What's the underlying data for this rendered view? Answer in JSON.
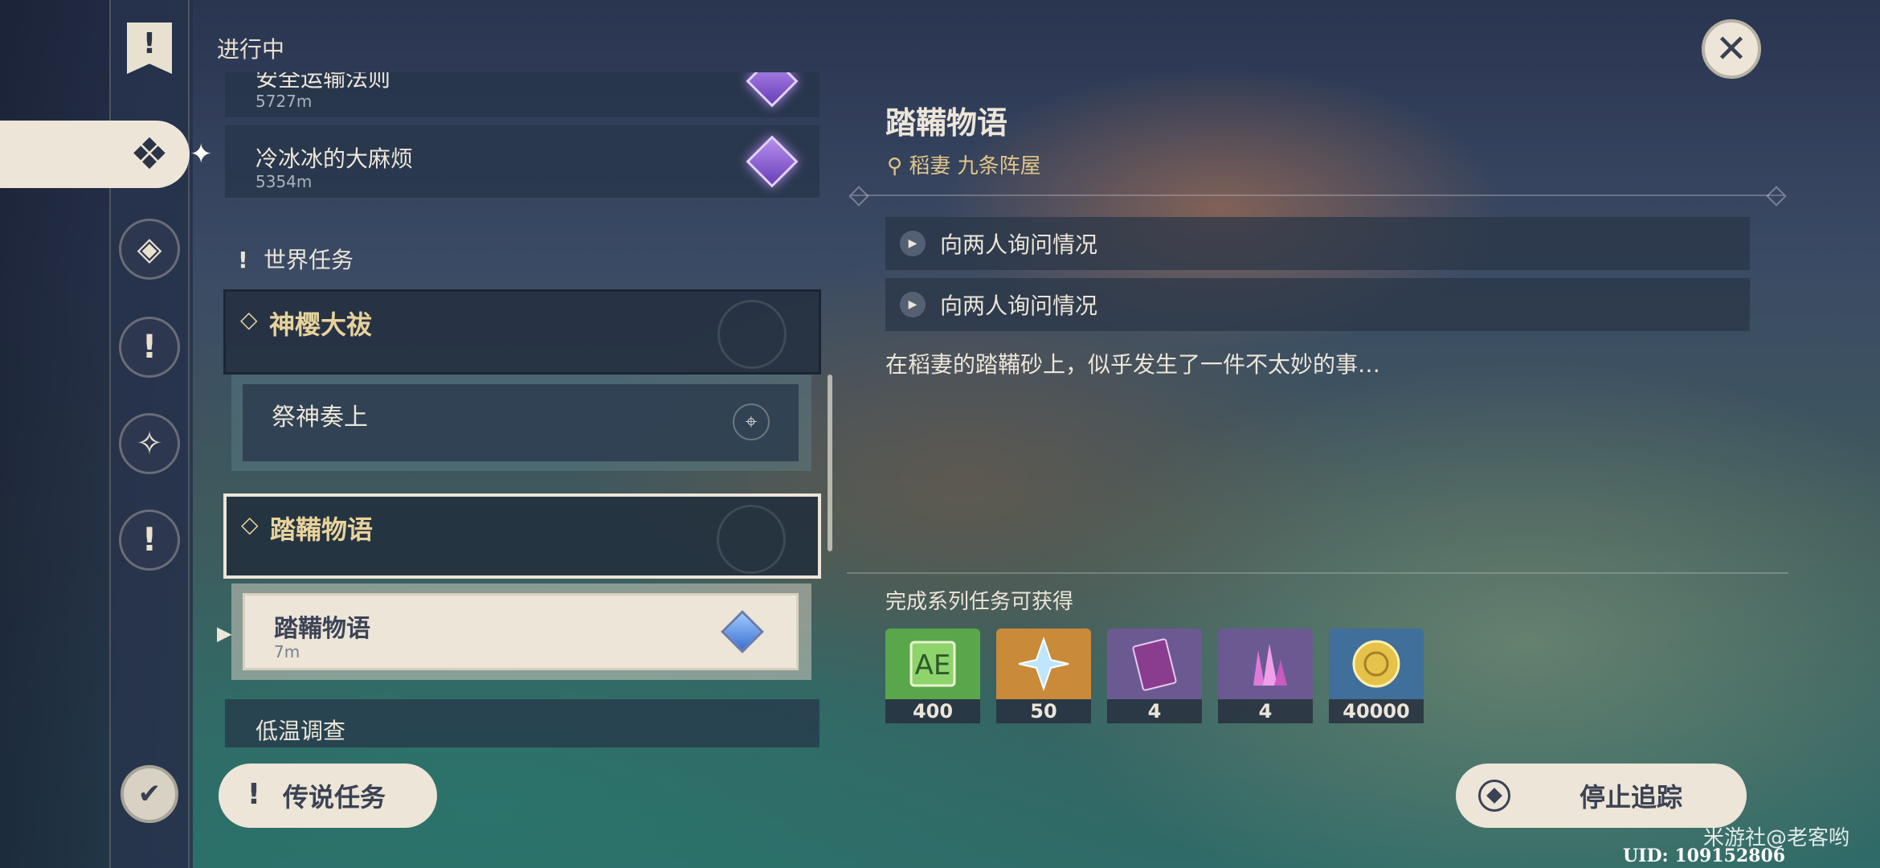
{
  "header": {
    "title": "进行中"
  },
  "quests_in_progress": [
    {
      "name": "安全运输法则",
      "distance": "5727m"
    },
    {
      "name": "冷冰冰的大麻烦",
      "distance": "5354m"
    }
  ],
  "section_world": {
    "label": "世界任务"
  },
  "groups": [
    {
      "title": "神樱大祓",
      "sub": {
        "name": "祭神奏上"
      }
    },
    {
      "title": "踏鞴物语",
      "sub": {
        "name": "踏鞴物语",
        "distance": "7m"
      }
    }
  ],
  "group_partial": {
    "title": "低温调查"
  },
  "legend_button": {
    "label": "传说任务"
  },
  "detail": {
    "title": "踏鞴物语",
    "location": "稻妻 九条阵屋",
    "steps": [
      "向两人询问情况",
      "向两人询问情况"
    ],
    "description": "在稻妻的踏鞴砂上，似乎发生了一件不太妙的事…",
    "rewards_label": "完成系列任务可获得",
    "rewards": [
      {
        "icon": "adventure-exp-icon",
        "count": "400",
        "color": "#5aa64a"
      },
      {
        "icon": "primogem-icon",
        "count": "50",
        "color": "#c98a3a"
      },
      {
        "icon": "heros-wit-book-icon",
        "count": "4",
        "color": "#6b5a92"
      },
      {
        "icon": "mystic-ore-crystal-icon",
        "count": "4",
        "color": "#6b5a92"
      },
      {
        "icon": "mora-coin-icon",
        "count": "40000",
        "color": "#3f6f9a"
      }
    ]
  },
  "stop_button": {
    "label": "停止追踪"
  },
  "watermark": "米游社@老客哟",
  "uid": "UID: 109152806"
}
